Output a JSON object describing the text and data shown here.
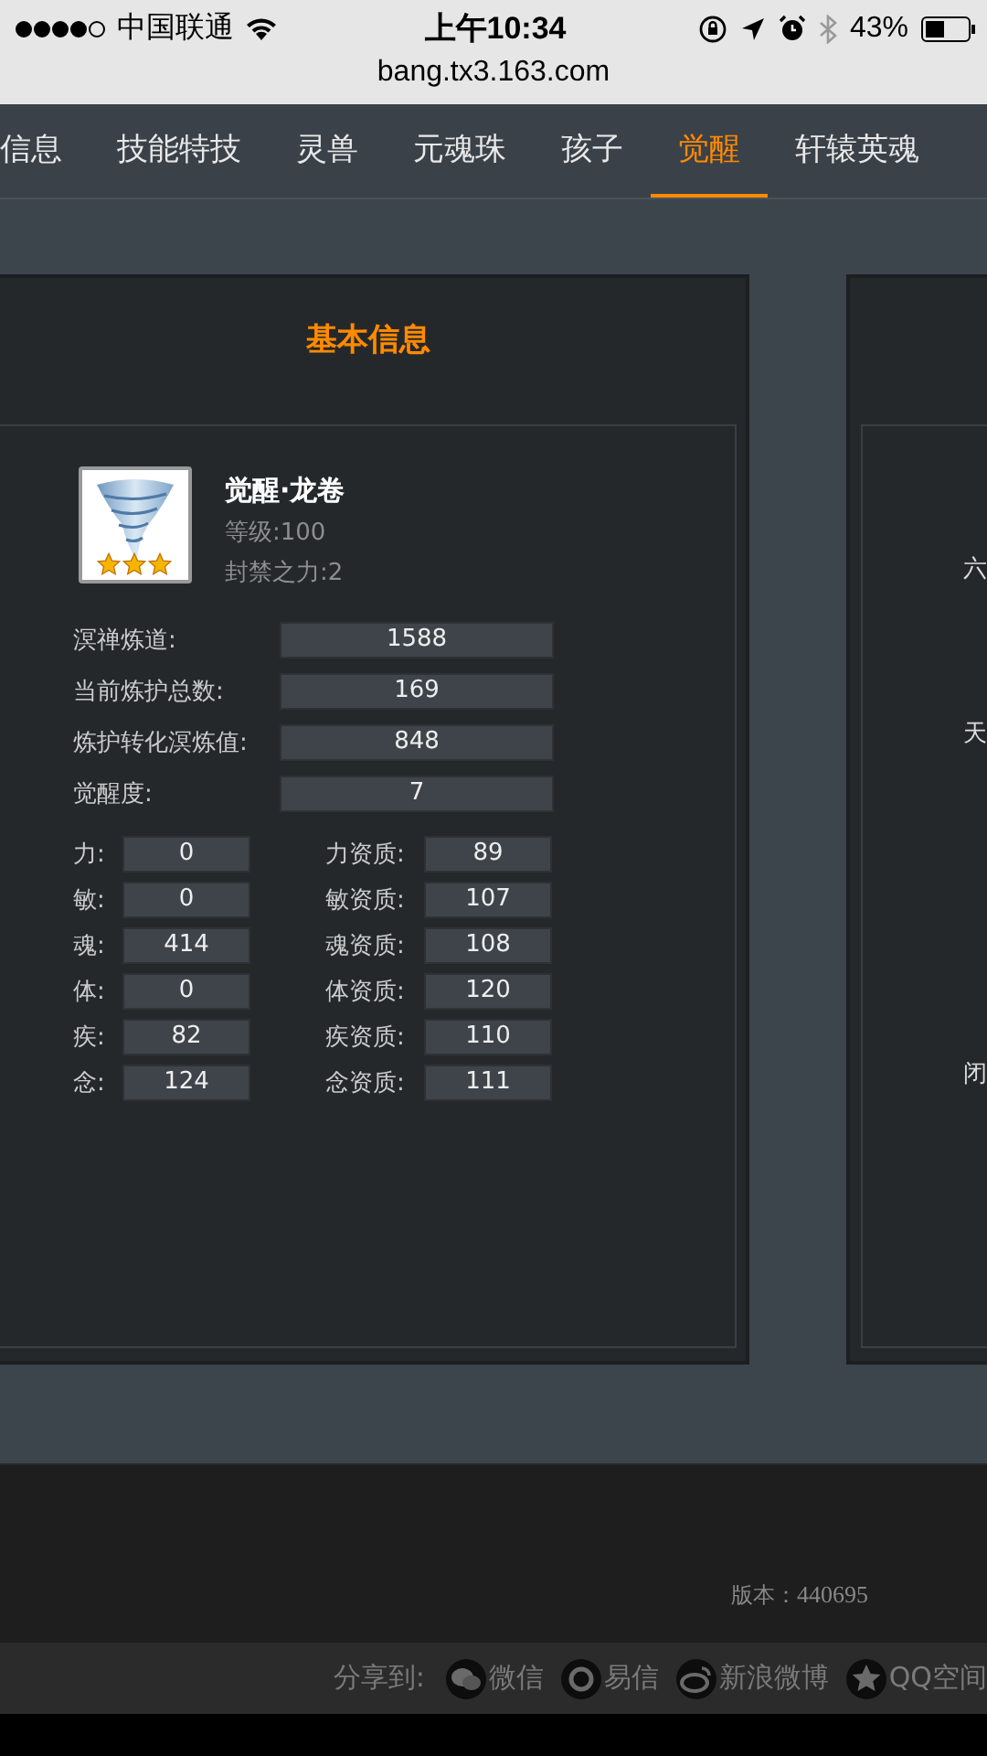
{
  "status_bar": {
    "carrier": "中国联通",
    "time": "上午10:34",
    "battery": "43%"
  },
  "address_bar": {
    "url": "bang.tx3.163.com"
  },
  "tabs": [
    {
      "label": "信息",
      "selected": false
    },
    {
      "label": "技能特技",
      "selected": false
    },
    {
      "label": "灵兽",
      "selected": false
    },
    {
      "label": "元魂珠",
      "selected": false
    },
    {
      "label": "孩子",
      "selected": false
    },
    {
      "label": "觉醒",
      "selected": true
    },
    {
      "label": "轩辕英魂",
      "selected": false
    }
  ],
  "info_panel": {
    "title": "基本信息",
    "name": "觉醒·龙卷",
    "level": "等级:100",
    "seal": "封禁之力:2",
    "stars": 3,
    "stats": [
      {
        "label": "溟禅炼道:",
        "value": "1588"
      },
      {
        "label": "当前炼护总数:",
        "value": "169"
      },
      {
        "label": "炼护转化溟炼值:",
        "value": "848"
      },
      {
        "label": "觉醒度:",
        "value": "7"
      }
    ],
    "attributes": [
      {
        "label": "力:",
        "value": "0",
        "quality_label": "力资质:",
        "quality_value": "89"
      },
      {
        "label": "敏:",
        "value": "0",
        "quality_label": "敏资质:",
        "quality_value": "107"
      },
      {
        "label": "魂:",
        "value": "414",
        "quality_label": "魂资质:",
        "quality_value": "108"
      },
      {
        "label": "体:",
        "value": "0",
        "quality_label": "体资质:",
        "quality_value": "120"
      },
      {
        "label": "疾:",
        "value": "82",
        "quality_label": "疾资质:",
        "quality_value": "110"
      },
      {
        "label": "念:",
        "value": "124",
        "quality_label": "念资质:",
        "quality_value": "111"
      }
    ]
  },
  "side_panel": {
    "labels": [
      "六",
      "天",
      "闭"
    ]
  },
  "footer": {
    "version_label": "版本：",
    "version": "440695"
  },
  "share_bar": {
    "label": "分享到:",
    "items": [
      {
        "kind": "wechat",
        "label": "微信"
      },
      {
        "kind": "yixin",
        "label": "易信"
      },
      {
        "kind": "weibo",
        "label": "新浪微博"
      },
      {
        "kind": "qzone",
        "label": "QQ空间"
      }
    ]
  }
}
